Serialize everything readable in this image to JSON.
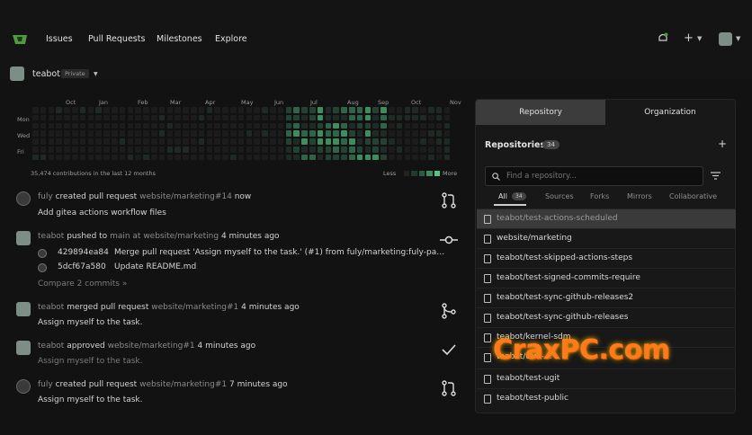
{
  "nav": {
    "links": [
      "Issues",
      "Pull Requests",
      "Milestones",
      "Explore"
    ],
    "plus_label": "+"
  },
  "user": {
    "name": "teabot",
    "badge": "Private"
  },
  "heatmap": {
    "months": [
      "Oct",
      "Jan",
      "Feb",
      "Mar",
      "Apr",
      "May",
      "Jun",
      "Jul",
      "Aug",
      "Sep",
      "Oct",
      "Nov"
    ],
    "days": [
      "Mon",
      "Wed",
      "Fri"
    ],
    "summary": "35,474 contributions in the last 12 months",
    "less_label": "Less",
    "more_label": "More"
  },
  "feed": [
    {
      "actor": "fuly",
      "action": "created pull request",
      "target": "website/marketing#14",
      "time": "now",
      "desc": "Add gitea actions workflow files",
      "icon": "pull-request-icon"
    },
    {
      "actor": "teabot",
      "action": "pushed to",
      "target": "main at website/marketing",
      "time": "4 minutes ago",
      "commits": [
        {
          "sha": "429894ea84",
          "msg": "Merge pull request 'Assign myself to the task.' (#1) from fuly/marketing:fuly-patch-..."
        },
        {
          "sha": "5dcf67a580",
          "msg": "Update README.md"
        }
      ],
      "compare": "Compare 2 commits »",
      "icon": "commit-icon"
    },
    {
      "actor": "teabot",
      "action": "merged pull request",
      "target": "website/marketing#1",
      "time": "4 minutes ago",
      "desc": "Assign myself to the task.",
      "icon": "merge-icon"
    },
    {
      "actor": "teabot",
      "action": "approved",
      "target": "website/marketing#1",
      "time": "4 minutes ago",
      "desc": "Assign myself to the task.",
      "icon": "check-icon"
    },
    {
      "actor": "fuly",
      "action": "created pull request",
      "target": "website/marketing#1",
      "time": "7 minutes ago",
      "desc": "Assign myself to the task.",
      "icon": "pull-request-icon"
    }
  ],
  "panel": {
    "tabs": [
      "Repository",
      "Organization"
    ],
    "header": "Repositories",
    "count": "34",
    "add_label": "+",
    "search_placeholder": "Find a repository...",
    "filters": [
      "All",
      "Sources",
      "Forks",
      "Mirrors",
      "Collaborative"
    ],
    "repos": [
      "teabot/test-actions-scheduled",
      "website/marketing",
      "teabot/test-skipped-actions-steps",
      "teabot/test-signed-commits-require",
      "teabot/test-sync-github-releases2",
      "teabot/test-sync-github-releases",
      "teabot/kernel-sdm",
      "teabot/test-...",
      "teabot/test-ugit",
      "teabot/test-public"
    ]
  },
  "watermark": "CraxPC.com"
}
